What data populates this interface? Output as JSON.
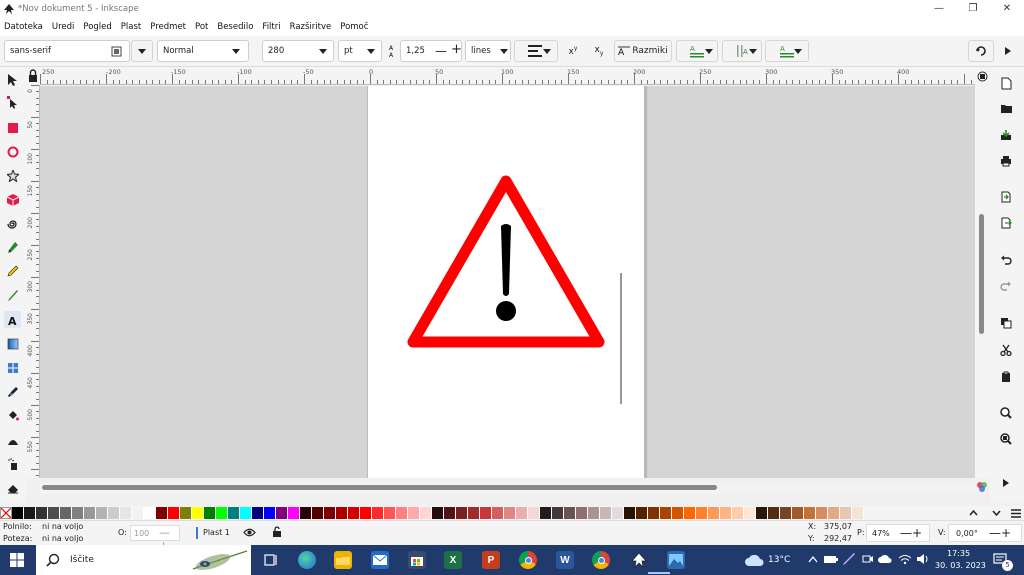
{
  "window": {
    "title": "*Nov dokument 5 - Inkscape"
  },
  "menu": [
    "Datoteka",
    "Uredi",
    "Pogled",
    "Plast",
    "Predmet",
    "Pot",
    "Besedilo",
    "Filtri",
    "Razširitve",
    "Pomoč"
  ],
  "text_toolbar": {
    "font_family": "sans-serif",
    "font_style": "Normal",
    "font_size": "280",
    "unit": "pt",
    "line_spacing": "1,25",
    "line_unit": "lines",
    "spacing_label": "Razmiki"
  },
  "ruler_top_labels": [
    "250",
    "-200",
    "-150",
    "-100",
    "-50",
    "0",
    "50",
    "100",
    "150",
    "200",
    "250",
    "300",
    "350",
    "400"
  ],
  "ruler_left_labels": [
    "0",
    "50",
    "100",
    "150",
    "200",
    "250",
    "300",
    "350",
    "400",
    "450",
    "500",
    "550"
  ],
  "palette": [
    "#000000",
    "#1a1a1a",
    "#333333",
    "#4d4d4d",
    "#666666",
    "#808080",
    "#999999",
    "#b3b3b3",
    "#cccccc",
    "#e6e6e6",
    "#f2f2f2",
    "#ffffff",
    "#800000",
    "#ff0000",
    "#808000",
    "#ffff00",
    "#008000",
    "#00ff00",
    "#008080",
    "#00ffff",
    "#000080",
    "#0000ff",
    "#800080",
    "#ff00ff",
    "#2b0000",
    "#550000",
    "#800000",
    "#aa0000",
    "#d40000",
    "#ff0000",
    "#ff2a2a",
    "#ff5555",
    "#ff8080",
    "#ffaaaa",
    "#ffd5d5",
    "#280b0b",
    "#501616",
    "#782121",
    "#a02c2c",
    "#c83737",
    "#d35f5f",
    "#de8787",
    "#e9afaf",
    "#f4d7d7",
    "#241c1c",
    "#483737",
    "#6c5353",
    "#916f6f",
    "#ac9393",
    "#c8b7b7",
    "#e3dbdb",
    "#2b1100",
    "#552200",
    "#803300",
    "#aa4400",
    "#d45500",
    "#ff6600",
    "#ff7f2a",
    "#ff9955",
    "#ffb380",
    "#ffccaa",
    "#ffe6d5",
    "#28170b",
    "#502d16",
    "#784421",
    "#a05a2c",
    "#c87137",
    "#d38d5f",
    "#deaa87",
    "#e9c6af",
    "#f4e3d7"
  ],
  "status": {
    "fill_label": "Polnilo:",
    "fill_value": "ni na voljo",
    "stroke_label": "Poteza:",
    "stroke_value": "ni na voljo",
    "opacity_label": "O:",
    "opacity_value": "100",
    "layer_label": "Plast 1",
    "x_label": "X:",
    "x_value": "375,07",
    "y_label": "Y:",
    "y_value": "292,47",
    "zoom_label": "P:",
    "zoom_value": "47%",
    "rotation_label": "V:",
    "rotation_value": "0,00°"
  },
  "taskbar": {
    "search_placeholder": "Iščite",
    "weather": "13°C",
    "time": "17:35",
    "date": "30. 03. 2023",
    "notification_count": "5"
  },
  "colors": {
    "warning_red": "#ff0000",
    "warning_black": "#000000",
    "taskbar_bg": "#1f3a6b"
  }
}
